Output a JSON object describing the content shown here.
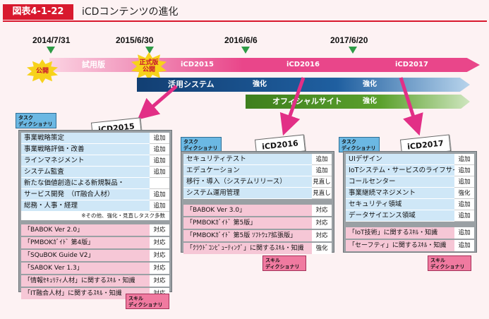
{
  "header": {
    "figure_label": "図表4-1-22",
    "title": "iCDコンテンツの進化"
  },
  "timeline": {
    "dates": [
      "2014/7/31",
      "2015/6/30",
      "2016/6/6",
      "2017/6/20"
    ],
    "badges": {
      "release": "公開",
      "official": "正式版\n公開"
    },
    "pink_band": {
      "trial": "試用版",
      "v2015": "iCD2015",
      "v2016": "iCD2016",
      "v2017": "iCD2017"
    },
    "blue_band": {
      "label": "活用システム",
      "s1": "強化",
      "s2": "強化"
    },
    "green_band": {
      "label": "オフィシャルサイト",
      "s1": "強化"
    }
  },
  "cube_labels": {
    "task": "タスク\nディクショナリ",
    "skill": "スキル\nディクショナリ"
  },
  "panels": [
    {
      "callout": "iCD2015",
      "task_rows": [
        {
          "t": "事業戦略策定",
          "s": "追加"
        },
        {
          "t": "事業戦略評価・改善",
          "s": "追加"
        },
        {
          "t": "ラインマネジメント",
          "s": "追加"
        },
        {
          "t": "システム監査",
          "s": "追加"
        },
        {
          "t": "新たな価値創造による新規製品・",
          "s": ""
        },
        {
          "t": "サービス開発　（IT融合人材）",
          "s": "追加"
        },
        {
          "t": "総務・人事・経理",
          "s": "追加"
        }
      ],
      "note": "※その他、強化・見直しタスク多数",
      "skill_rows": [
        {
          "t": "「BABOK Ver 2.0」",
          "s": "対応"
        },
        {
          "t": "「PMBOKｶﾞｲﾄﾞ 第4版」",
          "s": "対応"
        },
        {
          "t": "「SQuBOK Guide V2」",
          "s": "対応"
        },
        {
          "t": "「SABOK Ver 1.3」",
          "s": "対応"
        },
        {
          "t": "「情報ｾｷｭﾘﾃｨ人材」に関するｽｷﾙ・知識",
          "s": "対応"
        },
        {
          "t": "「IT融合人材」に関するｽｷﾙ・知識",
          "s": "対応"
        }
      ]
    },
    {
      "callout": "iCD2016",
      "task_rows": [
        {
          "t": "セキュリティテスト",
          "s": "追加"
        },
        {
          "t": "エデュケーション",
          "s": "追加"
        },
        {
          "t": "移行・導入（システムリリース）",
          "s": "見直し"
        },
        {
          "t": "システム運用管理",
          "s": "見直し"
        }
      ],
      "skill_rows": [
        {
          "t": "「BABOK Ver 3.0」",
          "s": "対応"
        },
        {
          "t": "「PMBOKｶﾞｲﾄﾞ 第5版」",
          "s": "対応"
        },
        {
          "t": "「PMBOKｶﾞｲﾄﾞ 第5版 ｿﾌﾄｳｪｱ拡張版」",
          "s": "対応"
        },
        {
          "t": "「ｸﾗｳﾄﾞｺﾝﾋﾟｭｰﾃｨﾝｸﾞ」に関するｽｷﾙ・知識",
          "s": "強化"
        }
      ]
    },
    {
      "callout": "iCD2017",
      "task_rows": [
        {
          "t": "UIデザイン",
          "s": "追加"
        },
        {
          "t": "IoTシステム・サービスのライフサイクル",
          "s": "追加"
        },
        {
          "t": "コールセンター",
          "s": "追加"
        },
        {
          "t": "事業継続マネジメント",
          "s": "強化"
        },
        {
          "t": "セキュリティ領域",
          "s": "追加"
        },
        {
          "t": "データサイエンス領域",
          "s": "追加"
        }
      ],
      "skill_rows": [
        {
          "t": "「IoT技術」に関するｽｷﾙ・知識",
          "s": "追加"
        },
        {
          "t": "「セーフティ」に関するｽｷﾙ・知識",
          "s": "追加"
        }
      ]
    }
  ],
  "colors": {
    "accent": "#d8192e",
    "pink_band": "#e9468a",
    "blue_band": "#1f5fa0",
    "green_band": "#5aa02c",
    "task_bg": "#cfe7f7",
    "skill_bg": "#f6c7d6"
  }
}
